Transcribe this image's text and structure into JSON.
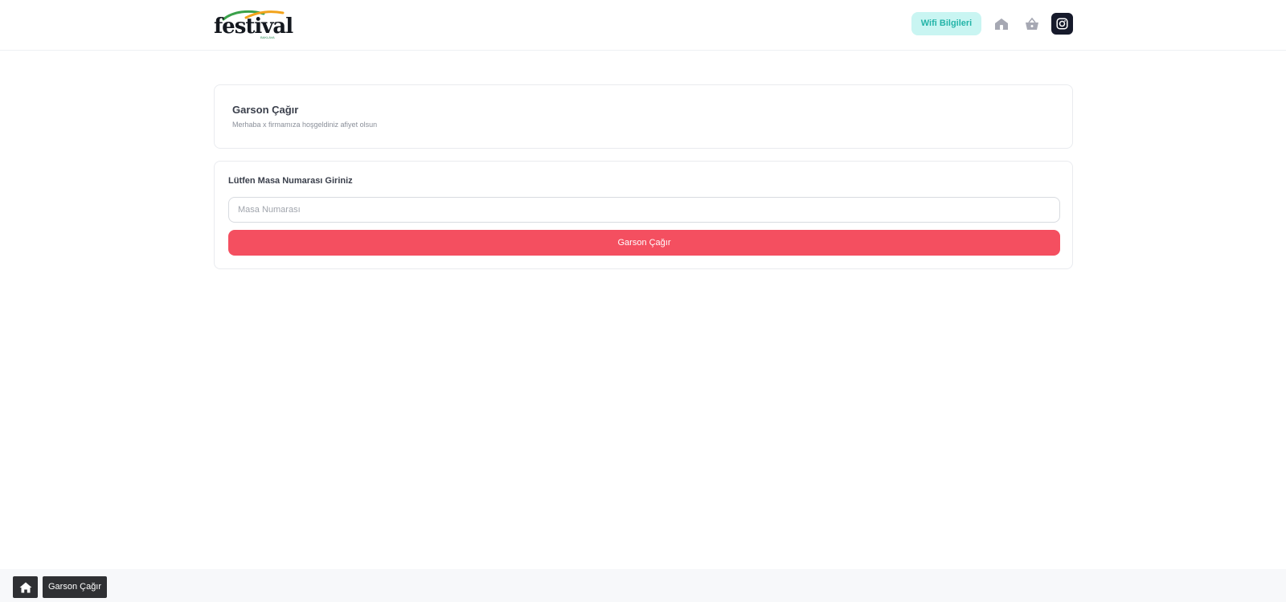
{
  "header": {
    "logo_text": "festival",
    "logo_small": "BAKLAVA",
    "wifi_label": "Wifi Bilgileri",
    "icons": [
      "home-icon",
      "basket-icon",
      "instagram-icon"
    ],
    "colors": {
      "wifi_bg": "#c9f5f2",
      "wifi_text": "#23b4a8",
      "instagram_bg": "#161a2b",
      "icon_gray": "#a6a8b3"
    }
  },
  "intro_card": {
    "title": "Garson Çağır",
    "subtitle": "Merhaba x firmamıza hoşgeldiniz afiyet olsun"
  },
  "form": {
    "label": "Lütfen Masa Numarası Giriniz",
    "input_value": "",
    "input_placeholder": "Masa Numarası",
    "submit_label": "Garson Çağır",
    "colors": {
      "submit_bg": "#f44f60"
    }
  },
  "footer": {
    "breadcrumb_label": "Garson Çağır",
    "icons": [
      "home-icon"
    ]
  }
}
